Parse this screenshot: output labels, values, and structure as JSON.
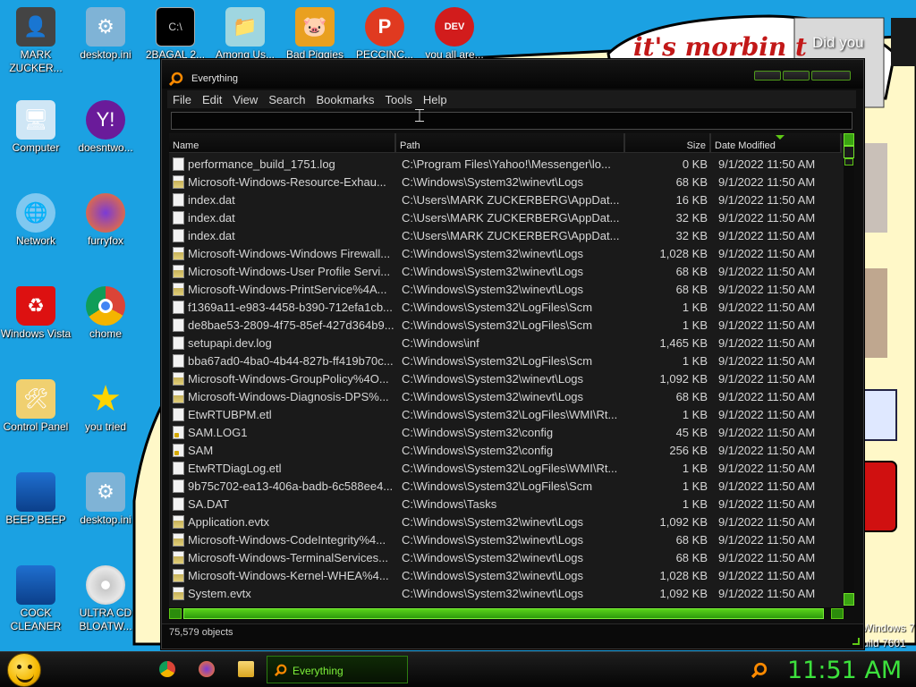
{
  "desktop": {
    "icons": [
      {
        "label": "MARK ZUCKER...",
        "icon": "user-folder-icon"
      },
      {
        "label": "desktop.ini",
        "icon": "settings-file-icon"
      },
      {
        "label": "2BAGAL 2...",
        "icon": "cmd-icon"
      },
      {
        "label": "Among Us...",
        "icon": "folder-icon"
      },
      {
        "label": "Bad Piggies",
        "icon": "pig-icon"
      },
      {
        "label": "PECCINC...",
        "icon": "p-app-icon"
      },
      {
        "label": "you all are...",
        "icon": "devcpp-icon"
      },
      {
        "label": "Computer",
        "icon": "computer-icon"
      },
      {
        "label": "doesntwo...",
        "icon": "yahoo-icon"
      },
      {
        "label": "Network",
        "icon": "network-icon"
      },
      {
        "label": "furryfox",
        "icon": "firefox-icon"
      },
      {
        "label": "Windows Vista",
        "icon": "recycle-bin-icon"
      },
      {
        "label": "chome",
        "icon": "chrome-icon"
      },
      {
        "label": "Control Panel",
        "icon": "control-panel-icon"
      },
      {
        "label": "you tried",
        "icon": "star-icon"
      },
      {
        "label": "BEEP BEEP",
        "icon": "shortcut-icon"
      },
      {
        "label": "desktop.ini",
        "icon": "settings-file-icon"
      },
      {
        "label": "COCK CLEANER",
        "icon": "shortcut-icon"
      },
      {
        "label": "ULTRA CD BLOATW...",
        "icon": "cd-icon"
      }
    ],
    "overlay_text": {
      "morbin": "it's morbin t",
      "did_you": "Did you",
      "watermark_line1": "Windows 7",
      "watermark_line2": "uild 7601"
    }
  },
  "window": {
    "title": "Everything",
    "menu": [
      "File",
      "Edit",
      "View",
      "Search",
      "Bookmarks",
      "Tools",
      "Help"
    ],
    "search": {
      "value": "",
      "placeholder": ""
    },
    "columns": {
      "name": "Name",
      "path": "Path",
      "size": "Size",
      "date": "Date Modified"
    },
    "rows": [
      {
        "name": "performance_build_1751.log",
        "path": "C:\\Program Files\\Yahoo!\\Messenger\\lo...",
        "size": "0 KB",
        "date": "9/1/2022 11:50 AM",
        "icon": "plain"
      },
      {
        "name": "Microsoft-Windows-Resource-Exhau...",
        "path": "C:\\Windows\\System32\\winevt\\Logs",
        "size": "68 KB",
        "date": "9/1/2022 11:50 AM",
        "icon": "log"
      },
      {
        "name": "index.dat",
        "path": "C:\\Users\\MARK ZUCKERBERG\\AppDat...",
        "size": "16 KB",
        "date": "9/1/2022 11:50 AM",
        "icon": "plain"
      },
      {
        "name": "index.dat",
        "path": "C:\\Users\\MARK ZUCKERBERG\\AppDat...",
        "size": "32 KB",
        "date": "9/1/2022 11:50 AM",
        "icon": "plain"
      },
      {
        "name": "index.dat",
        "path": "C:\\Users\\MARK ZUCKERBERG\\AppDat...",
        "size": "32 KB",
        "date": "9/1/2022 11:50 AM",
        "icon": "plain"
      },
      {
        "name": "Microsoft-Windows-Windows Firewall...",
        "path": "C:\\Windows\\System32\\winevt\\Logs",
        "size": "1,028 KB",
        "date": "9/1/2022 11:50 AM",
        "icon": "log"
      },
      {
        "name": "Microsoft-Windows-User Profile Servi...",
        "path": "C:\\Windows\\System32\\winevt\\Logs",
        "size": "68 KB",
        "date": "9/1/2022 11:50 AM",
        "icon": "log"
      },
      {
        "name": "Microsoft-Windows-PrintService%4A...",
        "path": "C:\\Windows\\System32\\winevt\\Logs",
        "size": "68 KB",
        "date": "9/1/2022 11:50 AM",
        "icon": "log"
      },
      {
        "name": "f1369a11-e983-4458-b390-712efa1cb...",
        "path": "C:\\Windows\\System32\\LogFiles\\Scm",
        "size": "1 KB",
        "date": "9/1/2022 11:50 AM",
        "icon": "plain"
      },
      {
        "name": "de8bae53-2809-4f75-85ef-427d364b9...",
        "path": "C:\\Windows\\System32\\LogFiles\\Scm",
        "size": "1 KB",
        "date": "9/1/2022 11:50 AM",
        "icon": "plain"
      },
      {
        "name": "setupapi.dev.log",
        "path": "C:\\Windows\\inf",
        "size": "1,465 KB",
        "date": "9/1/2022 11:50 AM",
        "icon": "plain"
      },
      {
        "name": "bba67ad0-4ba0-4b44-827b-ff419b70c...",
        "path": "C:\\Windows\\System32\\LogFiles\\Scm",
        "size": "1 KB",
        "date": "9/1/2022 11:50 AM",
        "icon": "plain"
      },
      {
        "name": "Microsoft-Windows-GroupPolicy%4O...",
        "path": "C:\\Windows\\System32\\winevt\\Logs",
        "size": "1,092 KB",
        "date": "9/1/2022 11:50 AM",
        "icon": "log"
      },
      {
        "name": "Microsoft-Windows-Diagnosis-DPS%...",
        "path": "C:\\Windows\\System32\\winevt\\Logs",
        "size": "68 KB",
        "date": "9/1/2022 11:50 AM",
        "icon": "log"
      },
      {
        "name": "EtwRTUBPM.etl",
        "path": "C:\\Windows\\System32\\LogFiles\\WMI\\Rt...",
        "size": "1 KB",
        "date": "9/1/2022 11:50 AM",
        "icon": "plain"
      },
      {
        "name": "SAM.LOG1",
        "path": "C:\\Windows\\System32\\config",
        "size": "45 KB",
        "date": "9/1/2022 11:50 AM",
        "icon": "lock"
      },
      {
        "name": "SAM",
        "path": "C:\\Windows\\System32\\config",
        "size": "256 KB",
        "date": "9/1/2022 11:50 AM",
        "icon": "lock"
      },
      {
        "name": "EtwRTDiagLog.etl",
        "path": "C:\\Windows\\System32\\LogFiles\\WMI\\Rt...",
        "size": "1 KB",
        "date": "9/1/2022 11:50 AM",
        "icon": "plain"
      },
      {
        "name": "9b75c702-ea13-406a-badb-6c588ee4...",
        "path": "C:\\Windows\\System32\\LogFiles\\Scm",
        "size": "1 KB",
        "date": "9/1/2022 11:50 AM",
        "icon": "plain"
      },
      {
        "name": "SA.DAT",
        "path": "C:\\Windows\\Tasks",
        "size": "1 KB",
        "date": "9/1/2022 11:50 AM",
        "icon": "plain"
      },
      {
        "name": "Application.evtx",
        "path": "C:\\Windows\\System32\\winevt\\Logs",
        "size": "1,092 KB",
        "date": "9/1/2022 11:50 AM",
        "icon": "log"
      },
      {
        "name": "Microsoft-Windows-CodeIntegrity%4...",
        "path": "C:\\Windows\\System32\\winevt\\Logs",
        "size": "68 KB",
        "date": "9/1/2022 11:50 AM",
        "icon": "log"
      },
      {
        "name": "Microsoft-Windows-TerminalServices...",
        "path": "C:\\Windows\\System32\\winevt\\Logs",
        "size": "68 KB",
        "date": "9/1/2022 11:50 AM",
        "icon": "log"
      },
      {
        "name": "Microsoft-Windows-Kernel-WHEA%4...",
        "path": "C:\\Windows\\System32\\winevt\\Logs",
        "size": "1,028 KB",
        "date": "9/1/2022 11:50 AM",
        "icon": "log"
      },
      {
        "name": "System.evtx",
        "path": "C:\\Windows\\System32\\winevt\\Logs",
        "size": "1,092 KB",
        "date": "9/1/2022 11:50 AM",
        "icon": "log"
      }
    ],
    "status": "75,579 objects"
  },
  "taskbar": {
    "pinned": [
      "chrome-icon",
      "firefox-icon",
      "explorer-icon"
    ],
    "active_task": "Everything",
    "clock": "11:51 AM"
  },
  "colors": {
    "desktop": "#1ba1e2",
    "accent_green": "#5fc916",
    "clock_green": "#3de23d",
    "window_bg": "#0e0e0e"
  }
}
